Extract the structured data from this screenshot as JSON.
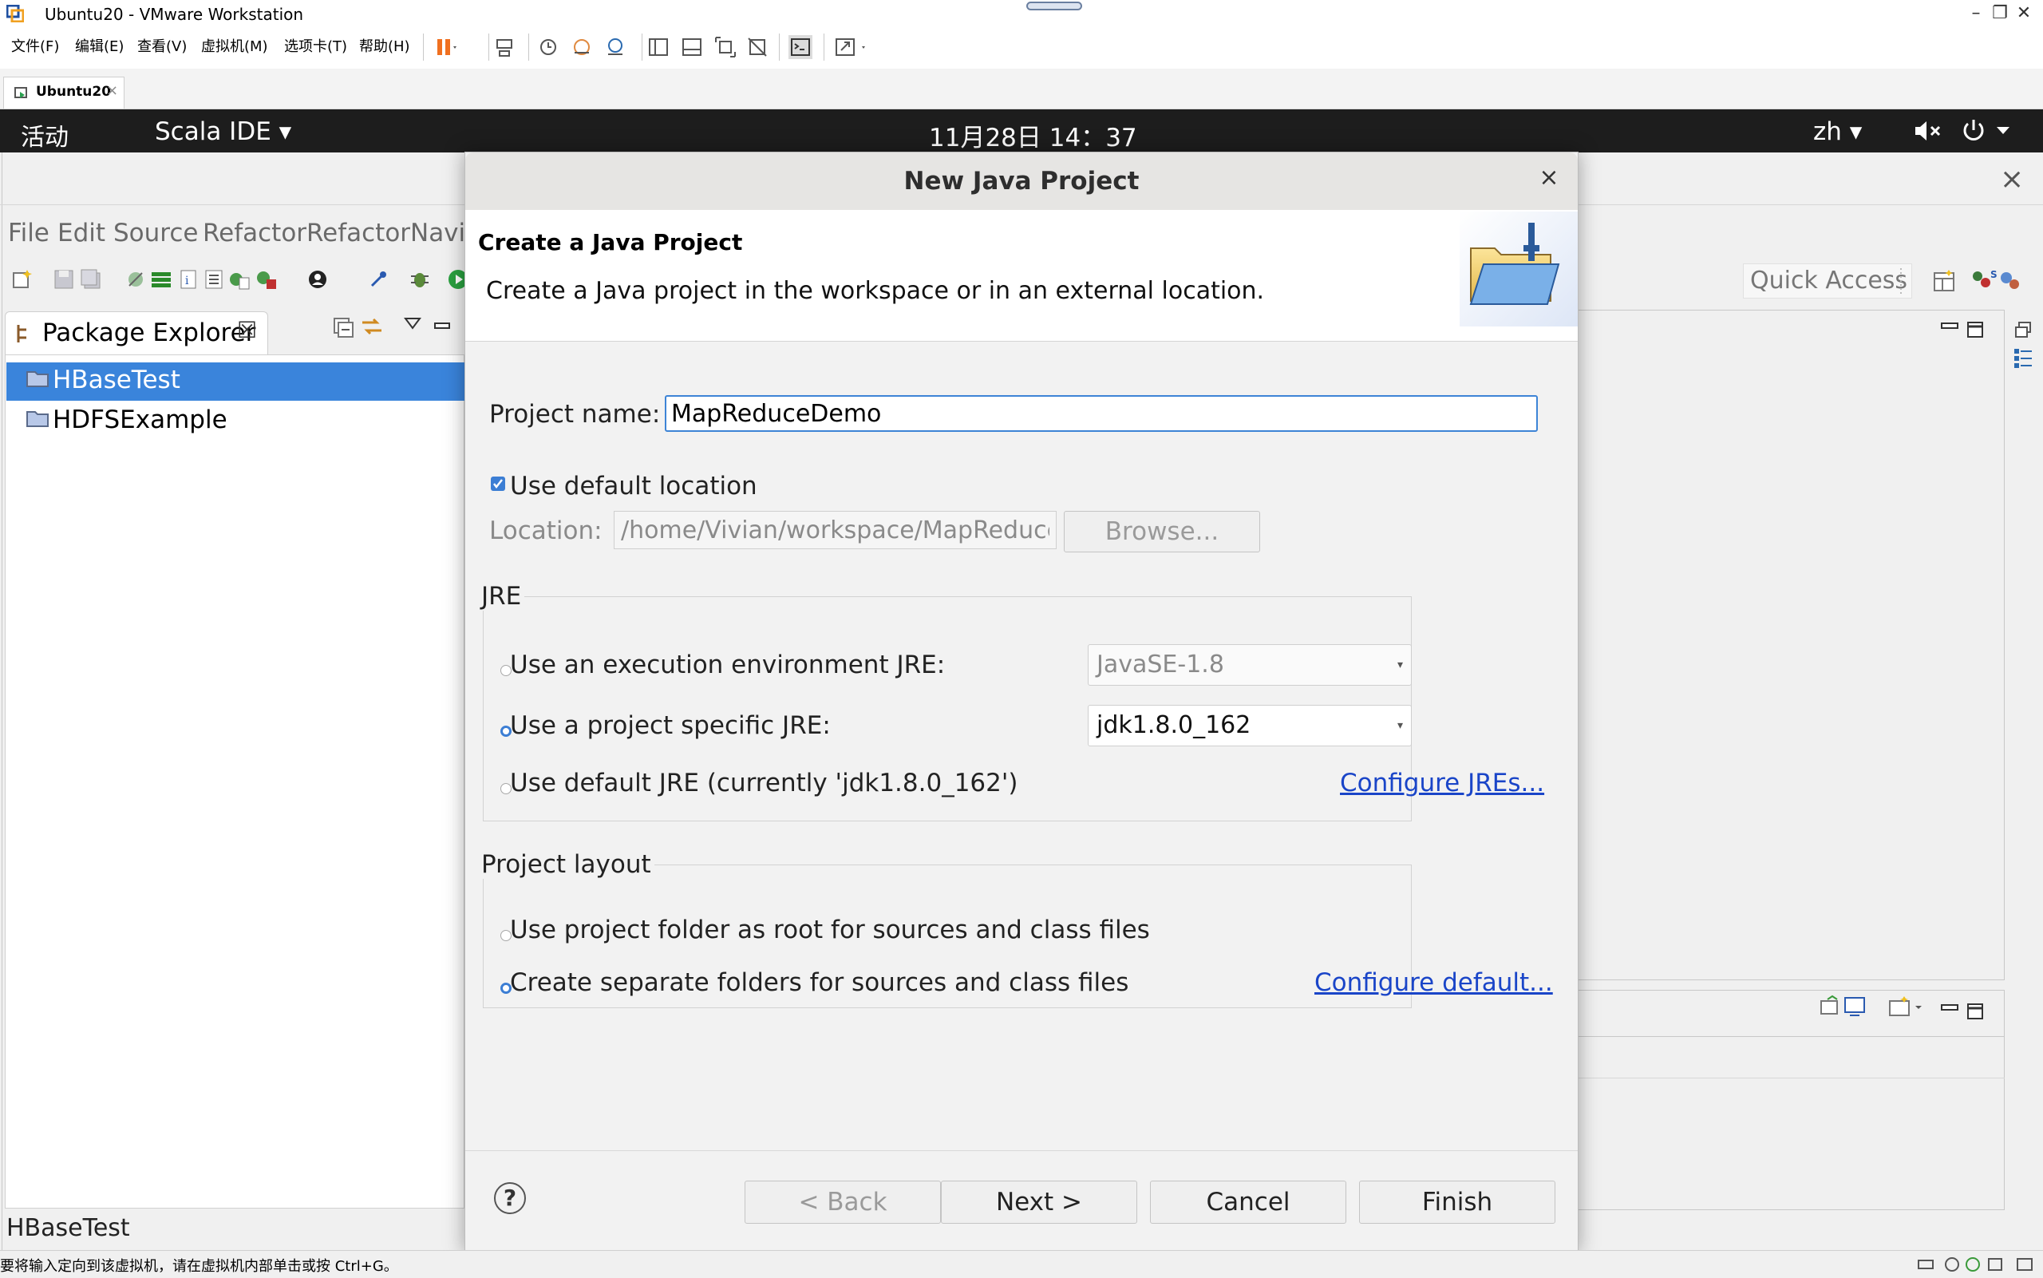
{
  "vmware": {
    "title": "Ubuntu20 - VMware Workstation",
    "menus": [
      "文件(F)",
      "编辑(E)",
      "查看(V)",
      "虚拟机(M)",
      "选项卡(T)",
      "帮助(H)"
    ],
    "tab_label": "Ubuntu20",
    "tab_close": "×",
    "status_text": "要将输入定向到该虚拟机，请在虚拟机内部单击或按 Ctrl+G。",
    "window_controls": {
      "minimize": "–",
      "restore": "❐",
      "close": "✕"
    }
  },
  "gnome": {
    "activities": "活动",
    "app_menu": "Scala IDE ▾",
    "clock": "11月28日  14：37",
    "language": "zh ▾"
  },
  "eclipse": {
    "menus": [
      "File",
      "Edit",
      "Source",
      "Refactor",
      "Refactor",
      "Navi"
    ],
    "quick_access": "Quick Access",
    "package_explorer": "Package Explorer",
    "package_explorer_close": "☒",
    "projects": [
      "HBaseTest",
      "HDFSExample"
    ],
    "status_text": "HBaseTest",
    "window_close": "×"
  },
  "dialog": {
    "title": "New Java Project",
    "close": "×",
    "heading": "Create a Java Project",
    "description": "Create a Java project in the workspace or in an external location.",
    "project_name_label": "Project name:",
    "project_name_value": "MapReduceDemo",
    "use_default_location_label": "Use default location",
    "use_default_location_checked": true,
    "location_label": "Location:",
    "location_value": "/home/Vivian/workspace/MapReduceDemo",
    "browse_button": "Browse...",
    "jre_group": {
      "title": "JRE",
      "options": [
        {
          "label": "Use an execution environment JRE:",
          "selected": false,
          "combo_value": "JavaSE-1.8",
          "combo_enabled": false
        },
        {
          "label": "Use a project specific JRE:",
          "selected": true,
          "combo_value": "jdk1.8.0_162",
          "combo_enabled": true
        },
        {
          "label": "Use default JRE (currently 'jdk1.8.0_162')",
          "selected": false
        }
      ],
      "configure_link": "Configure JREs..."
    },
    "layout_group": {
      "title": "Project layout",
      "options": [
        {
          "label": "Use project folder as root for sources and class files",
          "selected": false
        },
        {
          "label": "Create separate folders for sources and class files",
          "selected": true
        }
      ],
      "configure_link": "Configure default..."
    },
    "help": "?",
    "buttons": {
      "back": "< Back",
      "next": "Next >",
      "cancel": "Cancel",
      "finish": "Finish"
    }
  },
  "colors": {
    "selection": "#3a84db",
    "link": "#1a45c8",
    "gnome_bar": "#1d1d1d",
    "radio_selected": "#3c7ed4"
  }
}
